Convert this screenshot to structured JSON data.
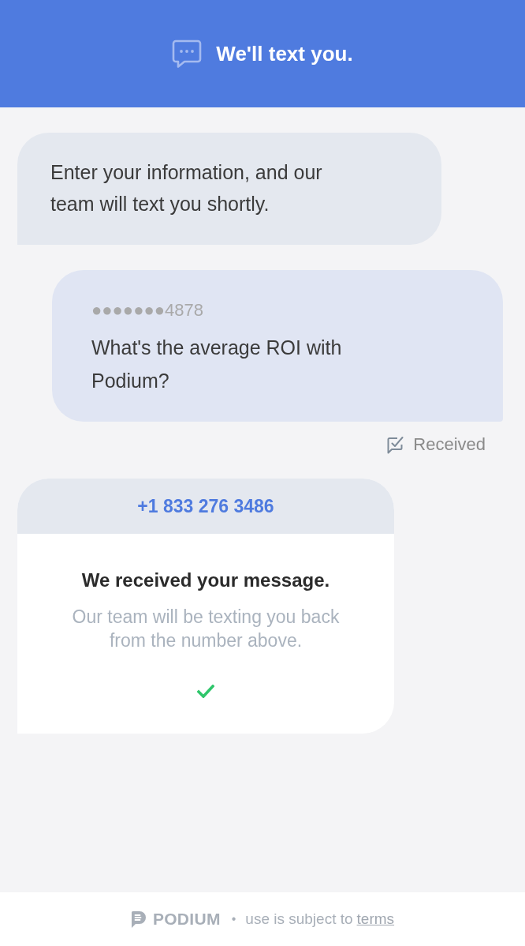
{
  "header": {
    "title": "We'll text you."
  },
  "messages": [
    {
      "kind": "incoming",
      "text": "Enter your information, and our team will text you shortly."
    },
    {
      "kind": "outgoing",
      "sender": "●●●●●●●4878",
      "text": "What's the average ROI with Podium?"
    }
  ],
  "status": {
    "label": "Received"
  },
  "confirmation": {
    "phone": "+1 833 276 3486",
    "title": "We received your message.",
    "body": "Our team will be texting you back from the number above."
  },
  "footer": {
    "brand": "PODIUM",
    "separator": "•",
    "notice": "use is subject to",
    "link": "terms"
  }
}
